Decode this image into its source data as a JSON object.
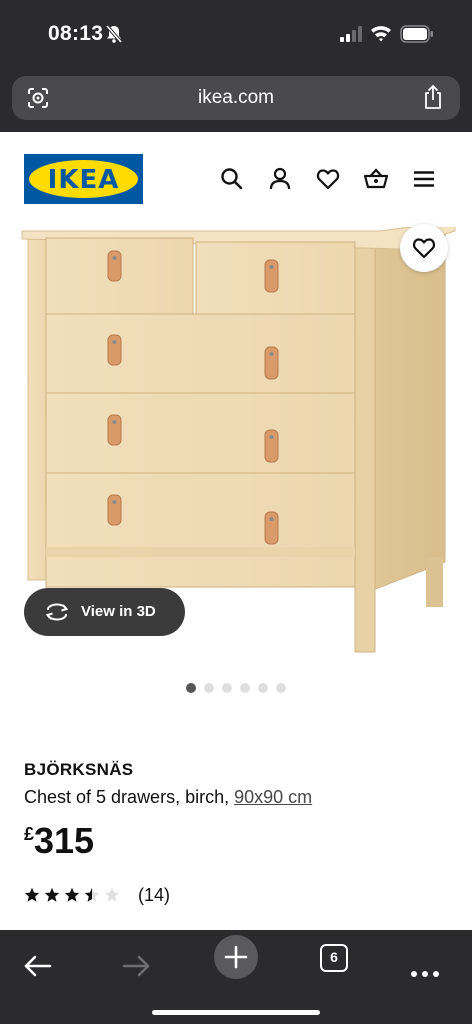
{
  "status_bar": {
    "time": "08:13"
  },
  "browser": {
    "url": "ikea.com",
    "tab_count": "6"
  },
  "brand": {
    "logo_text": "IKEA",
    "blue": "#0058a3",
    "yellow": "#ffdb00"
  },
  "header_icons": [
    "search-icon",
    "account-icon",
    "wishlist-heart-icon",
    "shopping-basket-icon",
    "menu-icon"
  ],
  "gallery": {
    "view3d_label": "View in 3D",
    "image_count": 6,
    "active_index": 0
  },
  "product": {
    "name": "BJÖRKSNÄS",
    "description": "Chest of 5 drawers, birch,",
    "dimensions": "90x90 cm",
    "price_currency": "£",
    "price_value": "315",
    "rating": 3.5,
    "rating_max": 5,
    "review_count": "(14)"
  }
}
